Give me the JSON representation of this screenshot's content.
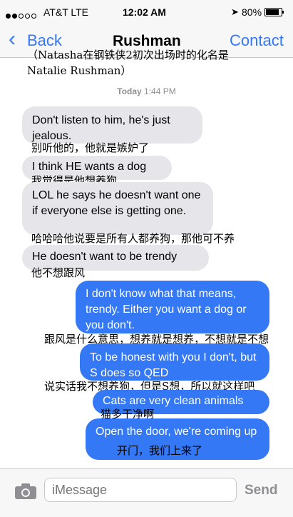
{
  "status": {
    "carrier": "AT&T LTE",
    "time": "12:02 AM",
    "battery": "80%"
  },
  "nav": {
    "back_label": "Back",
    "title": "Rushman",
    "contact_label": "Contact"
  },
  "annotation_top": "（Natasha在钢铁侠2初次出场时的化名是 Natalie Rushman）",
  "timestamp": {
    "day": "Today",
    "time": "1:44 PM"
  },
  "messages": [
    {
      "text": "Don't listen to him, he's just jealous.",
      "translation": "别听他的，他就是嫉妒了"
    },
    {
      "text": "I think HE wants a dog",
      "translation": "我觉得是他想养狗"
    },
    {
      "text": "LOL he says he doesn't want one if everyone else is getting one.",
      "translation": "哈哈哈他说要是所有人都养狗，那他可不养"
    },
    {
      "text": "He doesn't want to be trendy",
      "translation": "他不想跟风"
    },
    {
      "text": "I don't know what that means, trendy. Either you want a dog or you don't.",
      "translation": "跟风是什么意思，想养就是想养，不想就是不想"
    },
    {
      "text": "To be honest with you I don't, but S does so QED",
      "translation": "说实话我不想养狗，但是S想，所以就这样吧"
    },
    {
      "text": "Cats are very clean animals",
      "translation": "猫多干净啊"
    },
    {
      "text": "Open the door, we're coming up",
      "translation": "开门，我们上来了"
    }
  ],
  "input": {
    "placeholder": "iMessage",
    "send_label": "Send"
  },
  "colors": {
    "accent": "#3478f6",
    "incoming": "#e5e5ea",
    "outgoing": "#3478f6"
  }
}
